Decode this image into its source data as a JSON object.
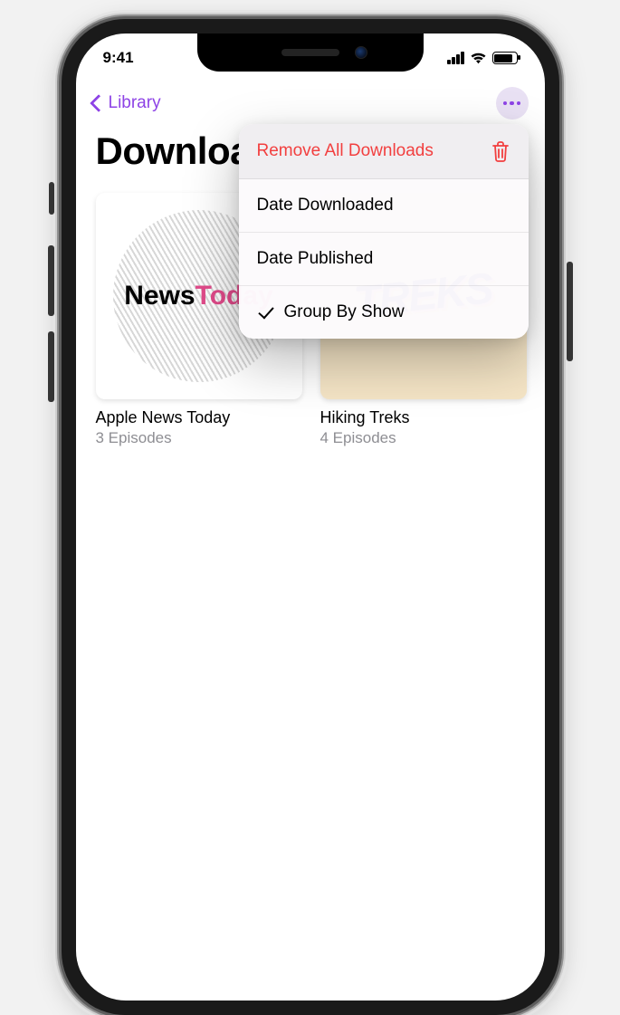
{
  "statusbar": {
    "time": "9:41"
  },
  "nav": {
    "back_label": "Library"
  },
  "page_title": "Downloaded",
  "menu": {
    "remove_all": "Remove All Downloads",
    "date_downloaded": "Date Downloaded",
    "date_published": "Date Published",
    "group_by_show": "Group By Show"
  },
  "shows": [
    {
      "title": "Apple News Today",
      "subtitle": "3 Episodes",
      "art_label_a": "News",
      "art_label_b": "Today"
    },
    {
      "title": "Hiking Treks",
      "subtitle": "4 Episodes",
      "art_label": "TREKS"
    }
  ]
}
